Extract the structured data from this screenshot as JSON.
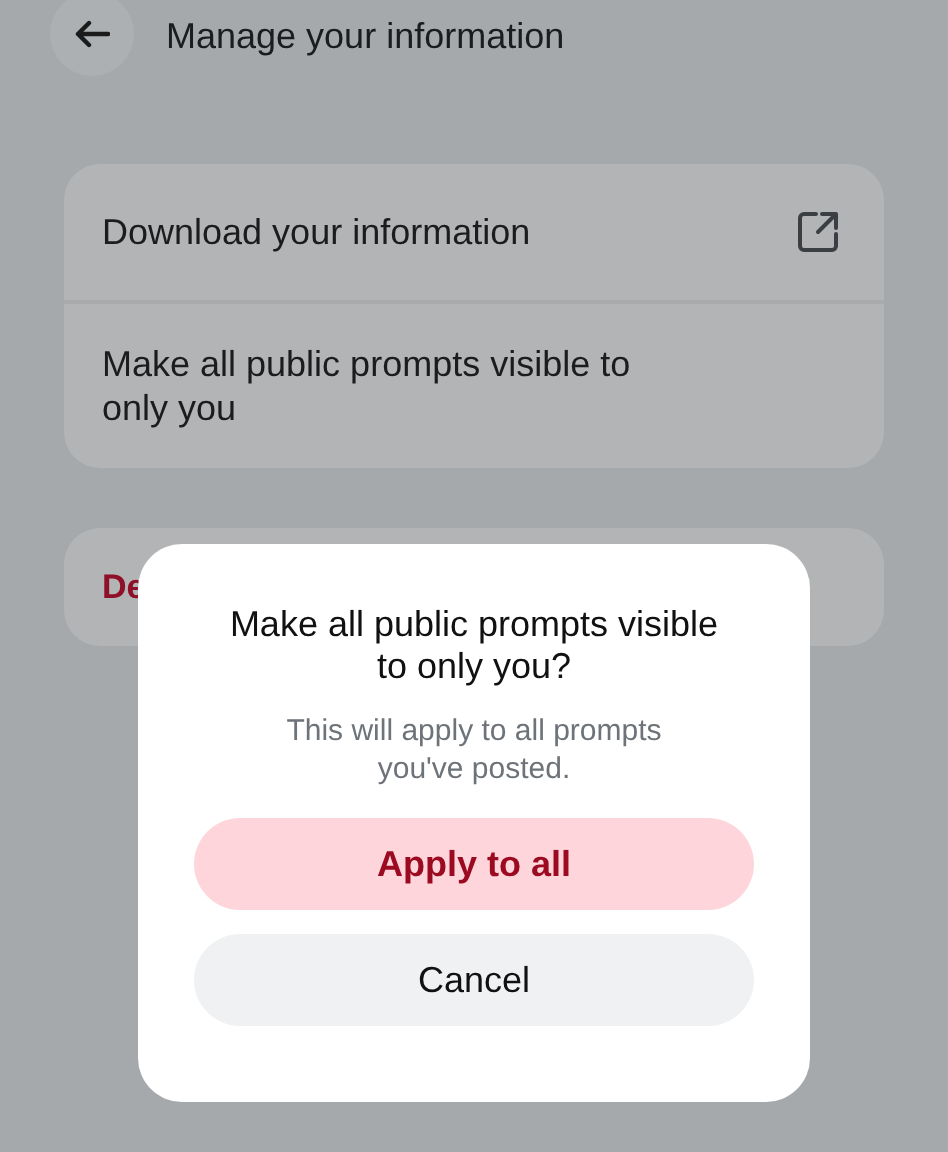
{
  "header": {
    "title": "Manage your information"
  },
  "menu_items": [
    {
      "label": "Download your information",
      "kind": "external"
    },
    {
      "label": "Make all public prompts visible to only you",
      "kind": "plain"
    }
  ],
  "danger_item": {
    "label": "De"
  },
  "dialog": {
    "title": "Make all public prompts visible to only you?",
    "message": "This will apply to all prompts you've posted.",
    "buttons": [
      {
        "label": "Apply to all",
        "kind": "primary"
      },
      {
        "label": "Cancel",
        "kind": "secondary"
      }
    ]
  }
}
